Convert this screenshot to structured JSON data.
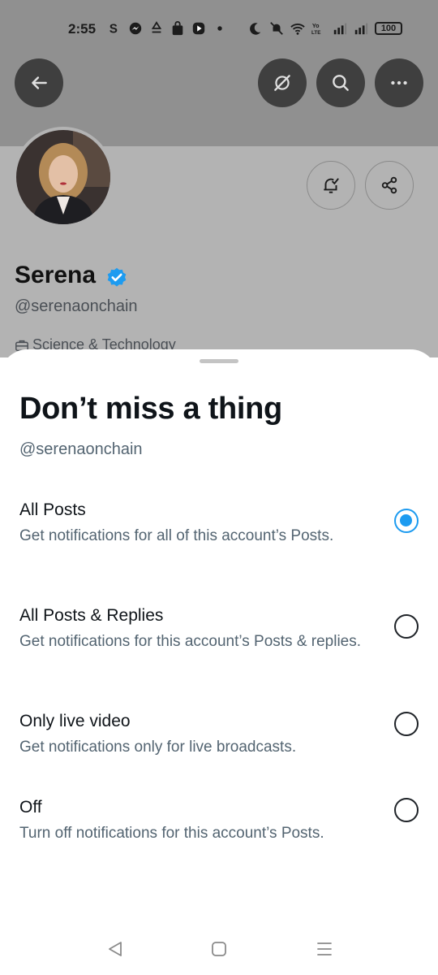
{
  "status_bar": {
    "time": "2:55",
    "battery": "100",
    "icons": [
      "skype-icon",
      "messenger-icon",
      "recycle-icon",
      "shopping-bag-icon",
      "play-icon",
      "dot-icon",
      "moon-icon",
      "mute-icon",
      "wifi-icon",
      "volte-icon",
      "signal-icon",
      "signal-icon"
    ]
  },
  "profile": {
    "name": "Serena",
    "handle": "@serenaonchain",
    "category": "Science & Technology",
    "verified_color": "#1d9bf0"
  },
  "header_buttons": [
    "back-icon",
    "grok-icon",
    "search-icon",
    "more-icon"
  ],
  "profile_buttons": [
    "notification-bell-icon",
    "share-icon"
  ],
  "sheet": {
    "title": "Don’t miss a thing",
    "subtitle": "@serenaonchain",
    "options": [
      {
        "title": "All Posts",
        "description": "Get notifications for all of this account’s Posts.",
        "selected": true
      },
      {
        "title": "All Posts & Replies",
        "description": "Get notifications for this account’s Posts & replies.",
        "selected": false
      },
      {
        "title": "Only live video",
        "description": "Get notifications only for live broadcasts.",
        "selected": false
      },
      {
        "title": "Off",
        "description": "Turn off notifications for this account’s Posts.",
        "selected": false
      }
    ]
  },
  "nav_bar": [
    "back-triangle-icon",
    "home-square-icon",
    "recents-menu-icon"
  ],
  "colors": {
    "accent": "#1d9bf0",
    "text_primary": "#0f1419",
    "text_secondary": "#536471"
  }
}
